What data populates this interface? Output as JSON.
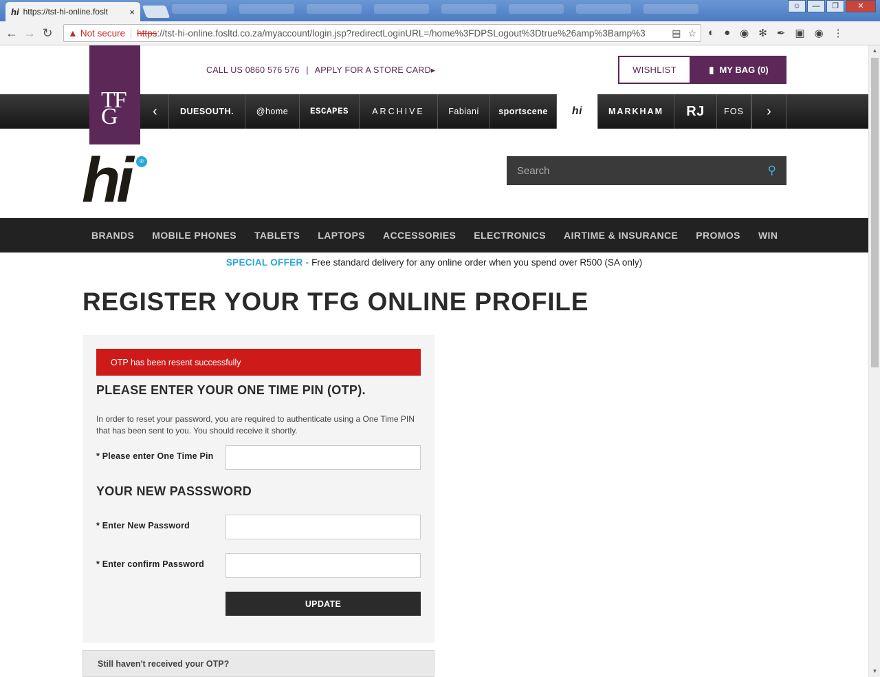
{
  "browser": {
    "tab_favicon": "hi",
    "tab_title": "https://tst-hi-online.foslt",
    "tab_close": "×",
    "security_warning": "Not secure",
    "url_scheme": "https",
    "url_rest": "://tst-hi-online.fosltd.co.za/myaccount/login.jsp?redirectLoginURL=/home%3FDPSLogout%3Dtrue%26amp%3Bamp%3",
    "win_minimize": "—",
    "win_restore": "❐",
    "win_close": "✕"
  },
  "header": {
    "tfg_logo": "TF\nG",
    "call_us": "CALL US 0860 576 576",
    "store_card": "APPLY FOR A STORE CARD",
    "store_card_arrow": "▸",
    "wishlist": "WISHLIST",
    "bag": "MY BAG (0)"
  },
  "brands": {
    "prev": "‹",
    "next": "›",
    "items": [
      "DUESOUTH.",
      "@home",
      "ESCAPES",
      "ARCHIVE",
      "Fabiani",
      "sportscene",
      "hi",
      "MARKHAM",
      "RJ",
      "FOS"
    ]
  },
  "site": {
    "logo": "hi",
    "logo_badge": "®"
  },
  "search": {
    "placeholder": "Search"
  },
  "nav": {
    "items": [
      "BRANDS",
      "MOBILE PHONES",
      "TABLETS",
      "LAPTOPS",
      "ACCESSORIES",
      "ELECTRONICS",
      "AIRTIME & INSURANCE",
      "PROMOS",
      "WIN"
    ]
  },
  "offer": {
    "highlight": "SPECIAL OFFER -",
    "text": " Free standard delivery for any online order when you spend over R500 (SA only)"
  },
  "page": {
    "title": "REGISTER YOUR TFG ONLINE PROFILE"
  },
  "form": {
    "alert": "OTP has been resent successfully",
    "otp_heading": "PLEASE ENTER YOUR ONE TIME PIN (OTP).",
    "intro": "In order to reset your password, you are required to authenticate using a One Time PIN that has been sent to you. You should receive it shortly.",
    "otp_label": "* Please enter One Time Pin",
    "otp_value": "",
    "pw_heading": "YOUR NEW PASSSWORD",
    "new_pw_label": "* Enter New Password",
    "new_pw_value": "",
    "confirm_pw_label": "* Enter confirm Password",
    "confirm_pw_value": "",
    "update_button": "UPDATE",
    "resend_prompt": "Still haven't received your OTP?"
  },
  "colors": {
    "brand_purple": "#5c2858",
    "accent_blue": "#2aa8d8",
    "alert_red": "#cf1a1a"
  }
}
